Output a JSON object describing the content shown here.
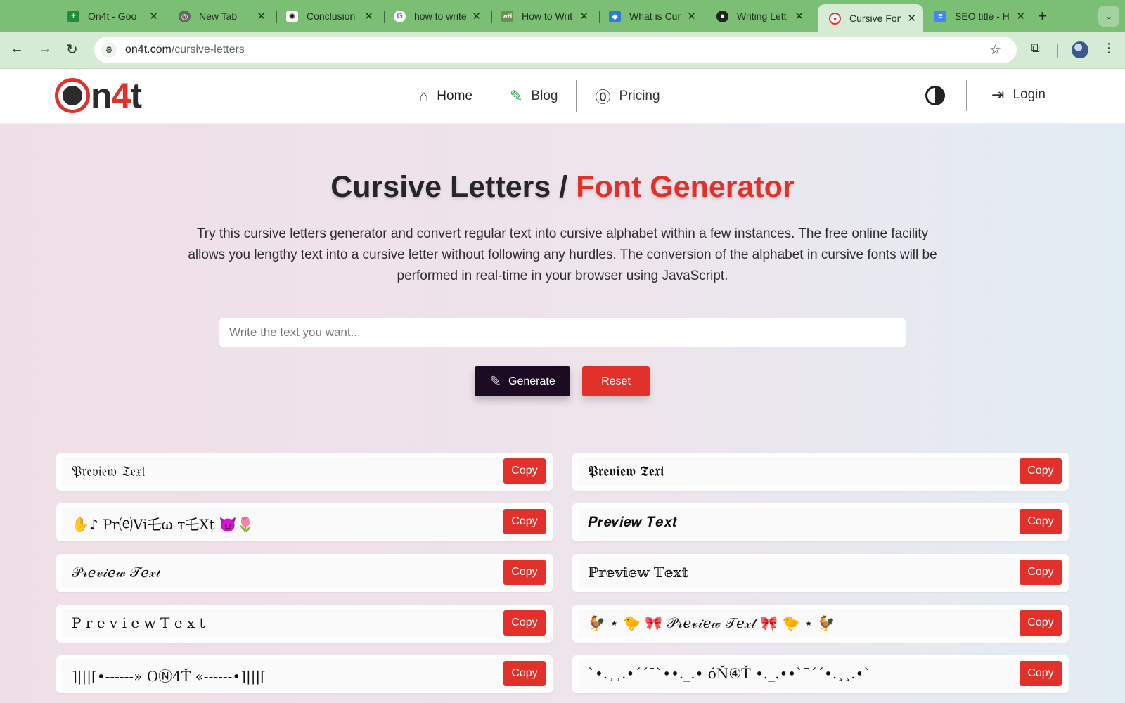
{
  "browser": {
    "tabs": [
      {
        "title": "On4t - Goo",
        "icon": "sheets-icon",
        "color": "#1e8e3e"
      },
      {
        "title": "New Tab",
        "icon": "chrome-icon",
        "color": "#555555"
      },
      {
        "title": "Conclusion",
        "icon": "openai-icon",
        "color": "#ffffff"
      },
      {
        "title": "how to write",
        "icon": "google-icon",
        "color": "#ffffff"
      },
      {
        "title": "How to Writ",
        "icon": "wikihow-icon",
        "color": "#6b8e4e"
      },
      {
        "title": "What is Cur",
        "icon": "site-icon",
        "color": "#2a7fd4"
      },
      {
        "title": "Writing Lett",
        "icon": "avatar-icon",
        "color": "#222222"
      },
      {
        "title": "Cursive Fon",
        "icon": "on4t-icon",
        "color": "#e2312a"
      },
      {
        "title": "SEO title - H",
        "icon": "docs-icon",
        "color": "#4285f4"
      }
    ],
    "url_domain": "on4t.com",
    "url_path": "/cursive-letters"
  },
  "header": {
    "logo_prefix": "n",
    "logo_four": "4",
    "logo_suffix": "t",
    "nav": [
      {
        "label": "Home"
      },
      {
        "label": "Blog"
      },
      {
        "label": "Pricing"
      }
    ],
    "login_label": "Login"
  },
  "hero": {
    "title_main": "Cursive Letters / ",
    "title_accent": "Font Generator",
    "description": "Try this cursive letters generator and convert regular text into cursive alphabet within a few instances. The free online facility allows you lengthy text into a cursive letter without following any hurdles. The conversion of the alphabet in cursive fonts will be performed in real-time in your browser using JavaScript."
  },
  "form": {
    "input_placeholder": "Write the text you want...",
    "input_value": "",
    "generate_label": "Generate",
    "reset_label": "Reset"
  },
  "results": {
    "copy_label": "Copy",
    "items": [
      "𝔓𝔯𝔢𝔳𝔦𝔢𝔴 𝔗𝔢𝔵𝔱",
      "𝕻𝖗𝖊𝖛𝖎𝖊𝖜 𝕿𝖊𝖝𝖙",
      "✋♪ Pr⒠Vi乇ω т乇Xt 😈🌷",
      "𝑷𝒓𝒆𝒗𝒊𝒆𝒘 𝑻𝒆𝒙𝒕",
      "𝒫𝓇𝑒𝓋𝒾𝑒𝓌 𝒯𝑒𝓍𝓉",
      "ℙ𝕣𝕖𝕧𝕚𝕖𝕨 𝕋𝕖𝕩𝕥",
      "P r e v i e w T e x t",
      "🐓 ⋆ 🐤 🎀 𝒫𝓇𝑒𝓋𝒾𝑒𝓌 𝒯𝑒𝓍𝓉 🎀 🐤 ⋆ 🐓",
      "]|||[•------» OⓃ4Ť «------•]|||[",
      "`•.¸¸.•´´¯`••._.• óŇ④Ť •._.••`¯´´•.¸¸.•`"
    ]
  }
}
